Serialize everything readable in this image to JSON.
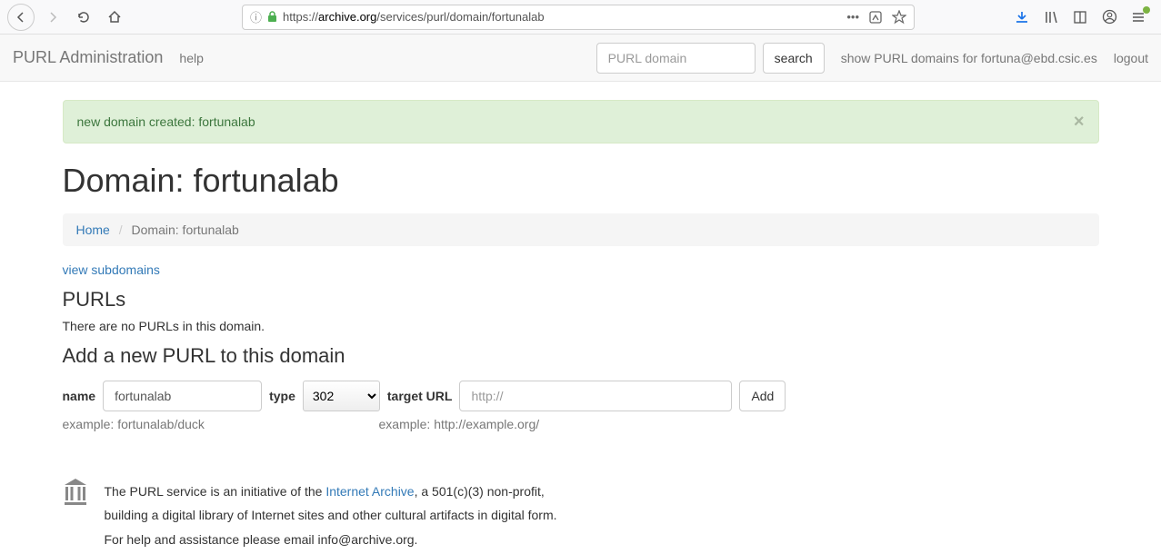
{
  "browser": {
    "url_prefix": "https://",
    "url_domain": "archive.org",
    "url_path": "/services/purl/domain/fortunalab"
  },
  "navbar": {
    "brand": "PURL Administration",
    "help": "help",
    "search_placeholder": "PURL domain",
    "search_btn": "search",
    "show_domains": "show PURL domains for fortuna@ebd.csic.es",
    "logout": "logout"
  },
  "alert": {
    "message": "new domain created: fortunalab"
  },
  "page": {
    "title": "Domain: fortunalab",
    "breadcrumb_home": "Home",
    "breadcrumb_active": "Domain: fortunalab",
    "view_subdomains": "view subdomains",
    "purls_heading": "PURLs",
    "purls_empty": "There are no PURLs in this domain.",
    "add_heading": "Add a new PURL to this domain"
  },
  "form": {
    "name_label": "name",
    "name_value": "fortunalab",
    "type_label": "type",
    "type_value": "302",
    "target_label": "target URL",
    "target_placeholder": "http://",
    "add_btn": "Add",
    "example_name": "example: fortunalab/duck",
    "example_target": "example: http://example.org/"
  },
  "footer": {
    "line1a": "The PURL service is an initiative of the ",
    "line1_link": "Internet Archive",
    "line1b": ", a 501(c)(3) non-profit,",
    "line2": "building a digital library of Internet sites and other cultural artifacts in digital form.",
    "line3": "For help and assistance please email info@archive.org."
  }
}
